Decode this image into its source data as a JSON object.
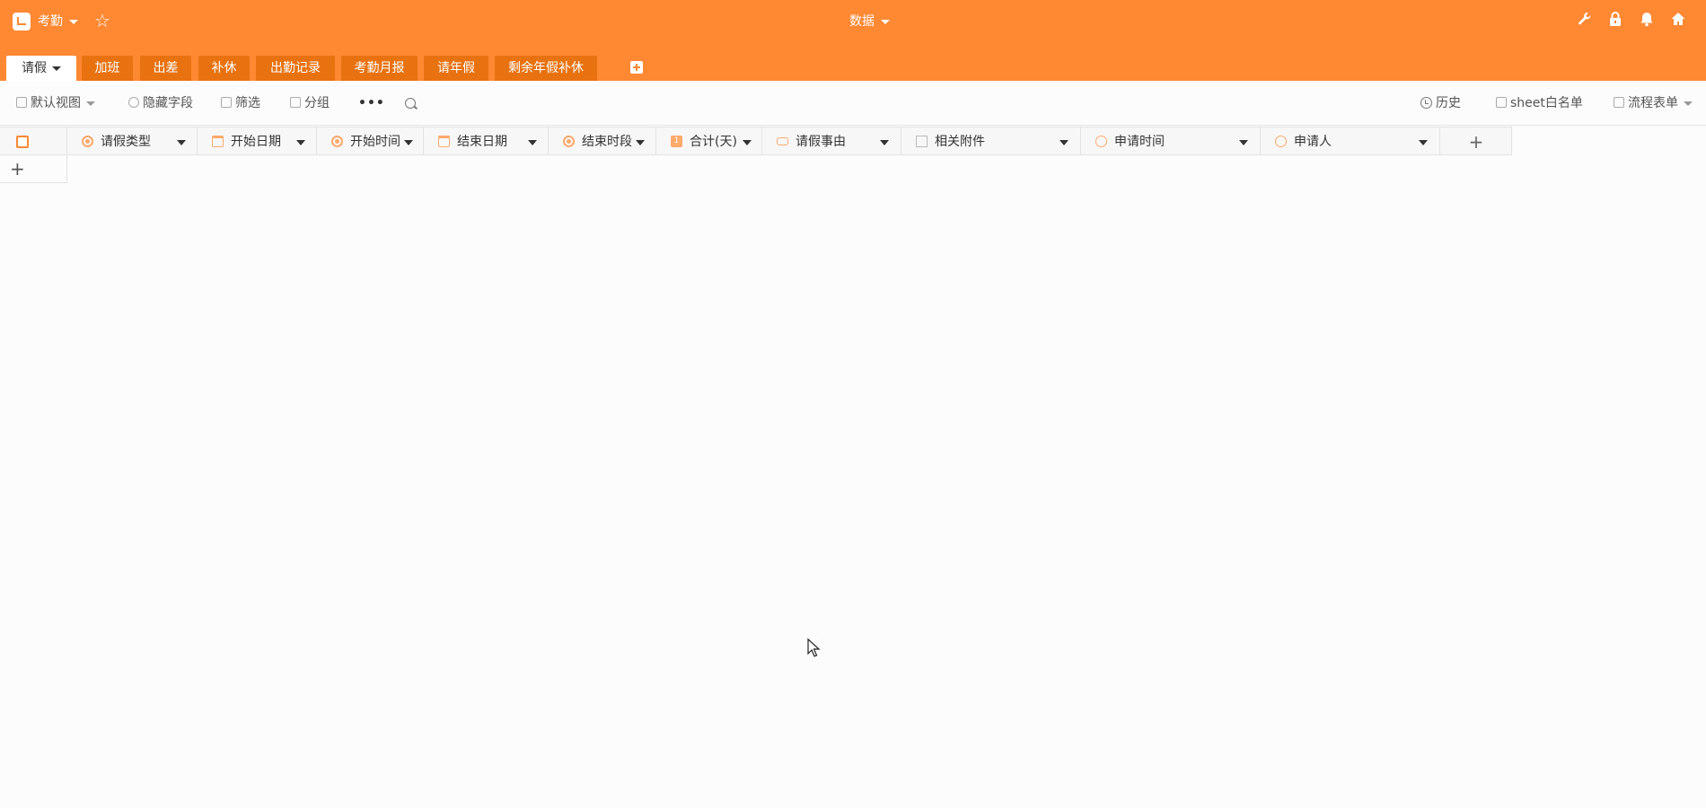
{
  "app": {
    "name": "考勤",
    "center_title": "数据"
  },
  "top_icons": [
    "wrench-icon",
    "lock-icon",
    "bell-icon",
    "home-icon"
  ],
  "tabs": [
    {
      "label": "请假",
      "active": true
    },
    {
      "label": "加班"
    },
    {
      "label": "出差"
    },
    {
      "label": "补休"
    },
    {
      "label": "出勤记录"
    },
    {
      "label": "考勤月报"
    },
    {
      "label": "请年假"
    },
    {
      "label": "剩余年假补休"
    }
  ],
  "toolbar": {
    "view": "默认视图",
    "hide_fields": "隐藏字段",
    "filter": "筛选",
    "group": "分组",
    "more": "•••",
    "history": "历史",
    "whitelist": "sheet白名单",
    "flow_form": "流程表单"
  },
  "columns": [
    {
      "label": "请假类型",
      "icon": "single-select-icon"
    },
    {
      "label": "开始日期",
      "icon": "calendar-icon"
    },
    {
      "label": "开始时间",
      "icon": "single-select-icon"
    },
    {
      "label": "结束日期",
      "icon": "calendar-icon"
    },
    {
      "label": "结束时段",
      "icon": "single-select-icon"
    },
    {
      "label": "合计(天)",
      "icon": "number-icon"
    },
    {
      "label": "请假事由",
      "icon": "text-icon"
    },
    {
      "label": "相关附件",
      "icon": "attachment-image-icon"
    },
    {
      "label": "申请时间",
      "icon": "clock-icon"
    },
    {
      "label": "申请人",
      "icon": "user-icon"
    }
  ],
  "add_column_symbol": "+",
  "add_row_symbol": "+",
  "colors": {
    "brand": "#ff8833",
    "tab_inactive": "#e87210",
    "icon_accent": "#ffa96a"
  }
}
